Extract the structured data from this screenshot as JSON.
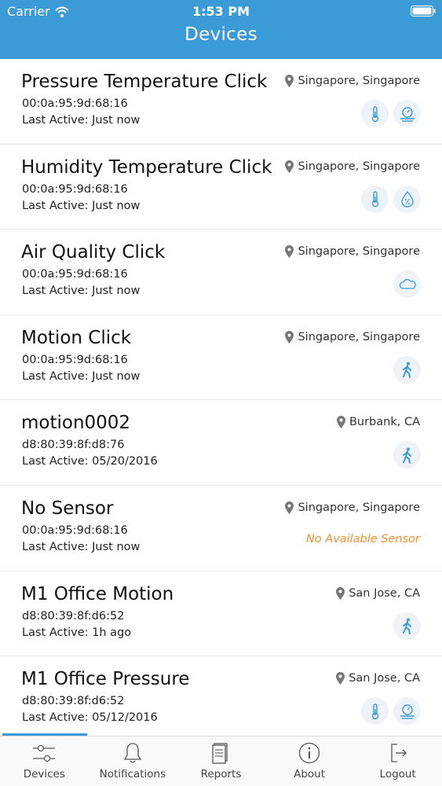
{
  "status_bar": {
    "carrier": "Carrier",
    "time": "1:53 PM"
  },
  "navbar": {
    "title": "Devices"
  },
  "devices": [
    {
      "name": "Pressure Temperature Click",
      "mac": "00:0a:95:9d:68:16",
      "last_active": "Last Active: Just now",
      "location": "Singapore, Singapore",
      "sensors": [
        "thermometer-icon",
        "pressure-icon"
      ]
    },
    {
      "name": "Humidity Temperature Click",
      "mac": "00:0a:95:9d:68:16",
      "last_active": "Last Active: Just now",
      "location": "Singapore, Singapore",
      "sensors": [
        "thermometer-icon",
        "humidity-icon"
      ]
    },
    {
      "name": "Air Quality Click",
      "mac": "00:0a:95:9d:68:16",
      "last_active": "Last Active: Just now",
      "location": "Singapore, Singapore",
      "sensors": [
        "cloud-icon"
      ]
    },
    {
      "name": "Motion Click",
      "mac": "00:0a:95:9d:68:16",
      "last_active": "Last Active: Just now",
      "location": "Singapore, Singapore",
      "sensors": [
        "walking-person-icon"
      ]
    },
    {
      "name": " motion0002",
      "mac": "d8:80:39:8f:d8:76",
      "last_active": "Last Active: 05/20/2016",
      "location": "Burbank, CA",
      "sensors": [
        "walking-person-icon"
      ]
    },
    {
      "name": "No Sensor",
      "mac": "00:0a:95:9d:68:16",
      "last_active": "Last Active: Just now",
      "location": "Singapore, Singapore",
      "sensors": [],
      "no_sensor_text": "No Available Sensor"
    },
    {
      "name": "M1 Office Motion",
      "mac": "d8:80:39:8f:d6:52",
      "last_active": "Last Active: 1h ago",
      "location": "San Jose, CA",
      "sensors": [
        "walking-person-icon"
      ]
    },
    {
      "name": "M1 Office Pressure",
      "mac": "d8:80:39:8f:d6:52",
      "last_active": "Last Active: 05/12/2016",
      "location": "San Jose, CA",
      "sensors": [
        "thermometer-icon",
        "pressure-icon"
      ]
    }
  ],
  "tabs": [
    {
      "label": "Devices",
      "icon": "sliders-icon"
    },
    {
      "label": "Notifications",
      "icon": "bell-icon"
    },
    {
      "label": "Reports",
      "icon": "report-icon"
    },
    {
      "label": "About",
      "icon": "info-icon"
    },
    {
      "label": "Logout",
      "icon": "logout-icon"
    }
  ],
  "colors": {
    "accent": "#3a9bd7",
    "warning": "#f0902a",
    "icon_bg": "#eef3f7"
  }
}
